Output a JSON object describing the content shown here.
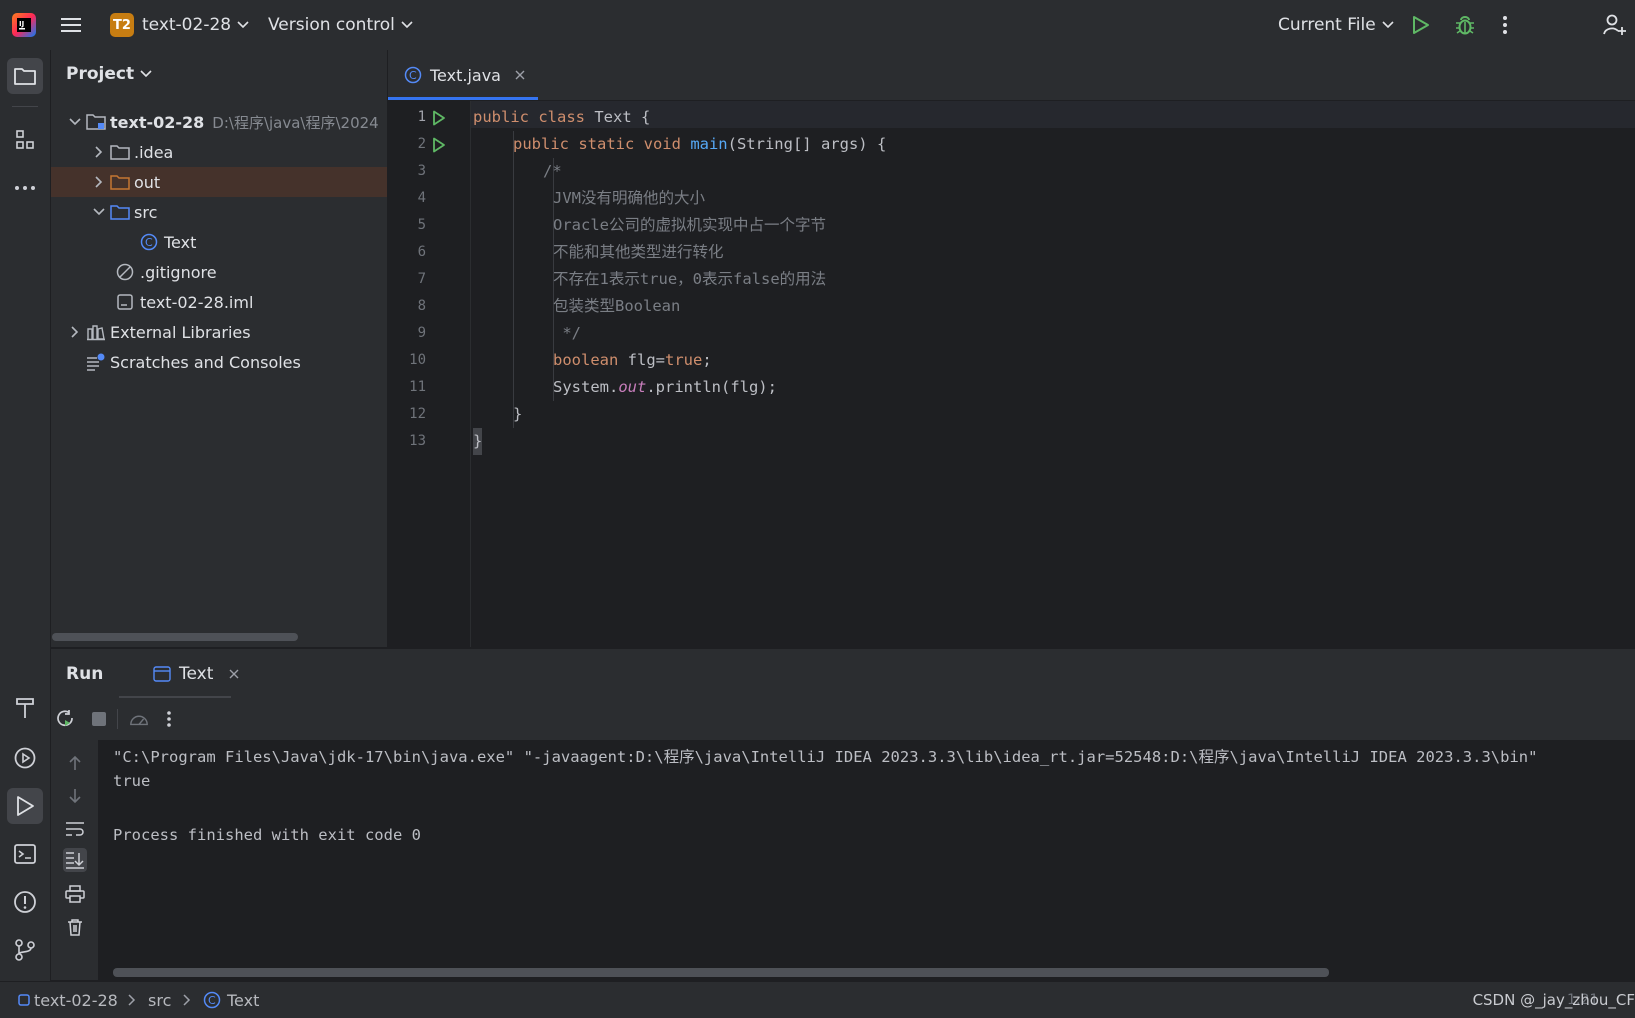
{
  "titlebar": {
    "project_badge": "T2",
    "project_name": "text-02-28",
    "version_control": "Version control",
    "run_config": "Current File"
  },
  "project_panel": {
    "title": "Project",
    "root_name": "text-02-28",
    "root_path": "D:\\程序\\java\\程序\\2024",
    "items": [
      {
        "label": ".idea"
      },
      {
        "label": "out"
      },
      {
        "label": "src"
      },
      {
        "label": "Text"
      },
      {
        "label": ".gitignore"
      },
      {
        "label": "text-02-28.iml"
      },
      {
        "label": "External Libraries"
      },
      {
        "label": "Scratches and Consoles"
      }
    ]
  },
  "editor": {
    "tab_label": "Text.java",
    "line_numbers": [
      "1",
      "2",
      "3",
      "4",
      "5",
      "6",
      "7",
      "8",
      "9",
      "10",
      "11",
      "12",
      "13"
    ],
    "code": {
      "l1_kw": "public class ",
      "l1_rest": "Text {",
      "l2_kw": "public static void ",
      "l2_fn": "main",
      "l2_rest": "(String[] args) {",
      "l3": "/*",
      "l4": "JVM没有明确他的大小",
      "l5": "Oracle公司的虚拟机实现中占一个字节",
      "l6": "不能和其他类型进行转化",
      "l7": "不存在1表示true，0表示false的用法",
      "l8": "包装类型Boolean",
      "l9": " */",
      "l10_kw": "boolean ",
      "l10_mid": "flg=",
      "l10_kw2": "true",
      "l10_end": ";",
      "l11_a": "System.",
      "l11_out": "out",
      "l11_b": ".println(flg);",
      "l12": "}",
      "l13": "}"
    }
  },
  "run_panel": {
    "title": "Run",
    "tab_label": "Text",
    "console_lines": [
      "\"C:\\Program Files\\Java\\jdk-17\\bin\\java.exe\" \"-javaagent:D:\\程序\\java\\IntelliJ IDEA 2023.3.3\\lib\\idea_rt.jar=52548:D:\\程序\\java\\IntelliJ IDEA 2023.3.3\\bin\"",
      "true",
      "",
      "Process finished with exit code 0"
    ]
  },
  "statusbar": {
    "crumbs": [
      "text-02-28",
      "src",
      "Text"
    ],
    "watermark": "CSDN @_jay_zhou_CF",
    "position": "1:21"
  },
  "colors": {
    "accent": "#3574f0",
    "run_green": "#5fb865",
    "badge": "#c77d12",
    "folder_orange": "#c57633",
    "folder_blue": "#548af7"
  }
}
